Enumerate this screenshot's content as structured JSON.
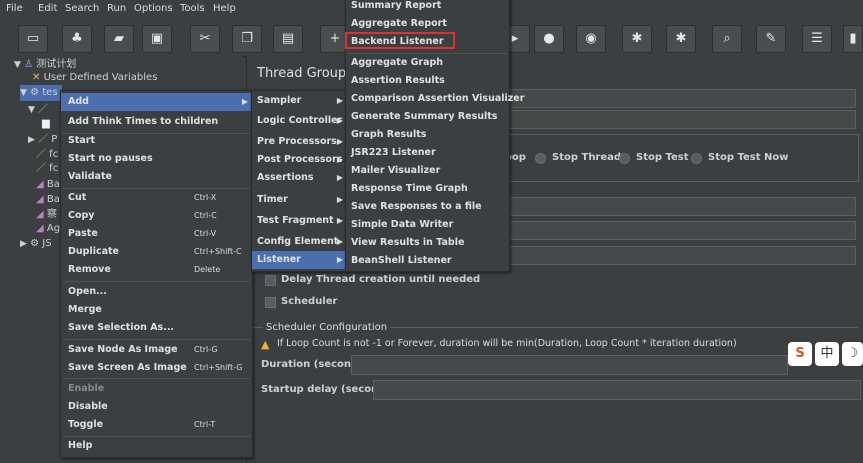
{
  "menubar": [
    "File",
    "Edit",
    "Search",
    "Run",
    "Options",
    "Tools",
    "Help"
  ],
  "tree": {
    "test_plan": "测试计划",
    "user_defined_variables": "User Defined Variables",
    "thread_group_short": "tes"
  },
  "panel": {
    "title": "Thread Group",
    "loop_options": [
      "oop",
      "Stop Thread",
      "Stop Test",
      "Stop Test Now"
    ],
    "delay_thread": "Delay Thread creation until needed",
    "scheduler": "Scheduler",
    "scheduler_config": "Scheduler Configuration",
    "warning": "If Loop Count is not -1 or Forever, duration will be min(Duration, Loop Count * iteration duration)",
    "duration_label": "Duration (seconds)",
    "startup_delay_label": "Startup delay (seconds)"
  },
  "context_menu": {
    "items": [
      {
        "label": "Add",
        "shortcut": "",
        "has_sub": true
      },
      {
        "label": "Add Think Times to children",
        "shortcut": ""
      },
      {
        "label": "Start",
        "shortcut": ""
      },
      {
        "label": "Start no pauses",
        "shortcut": ""
      },
      {
        "label": "Validate",
        "shortcut": ""
      },
      {
        "label": "Cut",
        "shortcut": "Ctrl-X"
      },
      {
        "label": "Copy",
        "shortcut": "Ctrl-C"
      },
      {
        "label": "Paste",
        "shortcut": "Ctrl-V"
      },
      {
        "label": "Duplicate",
        "shortcut": "Ctrl+Shift-C"
      },
      {
        "label": "Remove",
        "shortcut": "Delete"
      },
      {
        "label": "Open...",
        "shortcut": ""
      },
      {
        "label": "Merge",
        "shortcut": ""
      },
      {
        "label": "Save Selection As...",
        "shortcut": ""
      },
      {
        "label": "Save Node As Image",
        "shortcut": "Ctrl-G"
      },
      {
        "label": "Save Screen As Image",
        "shortcut": "Ctrl+Shift-G"
      },
      {
        "label": "Enable",
        "shortcut": ""
      },
      {
        "label": "Disable",
        "shortcut": ""
      },
      {
        "label": "Toggle",
        "shortcut": "Ctrl-T"
      },
      {
        "label": "Help",
        "shortcut": ""
      }
    ]
  },
  "add_submenu": [
    "Sampler",
    "Logic Controller",
    "Pre Processors",
    "Post Processors",
    "Assertions",
    "Timer",
    "Test Fragment",
    "Config Element",
    "Listener"
  ],
  "listener_submenu": [
    "Summary Report",
    "Aggregate Report",
    "Backend Listener",
    "Aggregate Graph",
    "Assertion Results",
    "Comparison Assertion Visualizer",
    "Generate Summary Results",
    "Graph Results",
    "JSR223 Listener",
    "Mailer Visualizer",
    "Response Time Graph",
    "Save Responses to a file",
    "Simple Data Writer",
    "View Results in Table",
    "BeanShell Listener"
  ],
  "ime": [
    "S",
    "中",
    "☽"
  ],
  "colors": {
    "selected": "#4b6eaf",
    "highlight": "#e03030",
    "bg": "#3c3f41"
  }
}
